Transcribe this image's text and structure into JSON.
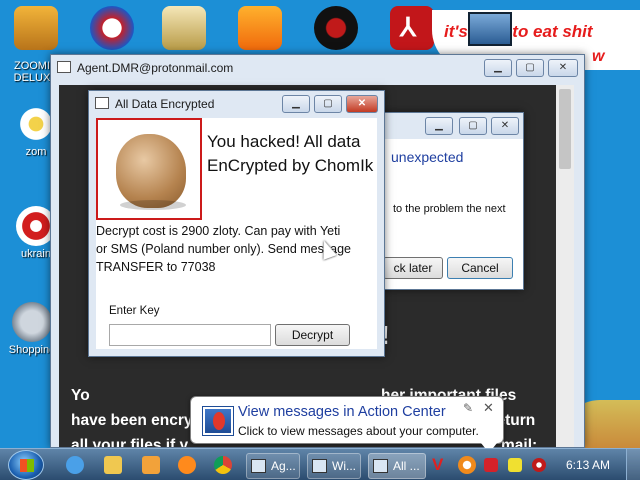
{
  "desktop": {
    "icons": [
      {
        "label_line1": "ZOOMI",
        "label_line2": "DELUX"
      },
      {
        "label_line1": "zom",
        "label_line2": ""
      },
      {
        "label_line1": "ukrain",
        "label_line2": ""
      },
      {
        "label_line1": "Shopping",
        "label_line2": ""
      }
    ],
    "banner_text": "it's time to eat shit",
    "banner_text_tail": "w"
  },
  "main_window": {
    "title": "Agent.DMR@protonmail.com",
    "body_lines": [
      "Yo",
      "have been encrypted with strongest encryption, you can return",
      "all your files if y"
    ],
    "right_fragment": "her important files",
    "right_fragment2": "mail:",
    "exclaim": "!"
  },
  "back_dialog": {
    "heading": "unexpected",
    "text": "to the problem the next",
    "later_label": "ck later",
    "cancel_label": "Cancel"
  },
  "ransom_dialog": {
    "title": "All Data Encrypted",
    "headline_line1": "You hacked! All data",
    "headline_line2": "EnCrypted by ChomIk",
    "message_line1": "Decrypt cost is 2900 zloty. Can pay with Yeti",
    "message_line2": "or SMS (Poland number only). Send message",
    "message_line3": "TRANSFER to 77038",
    "key_label": "Enter Key",
    "key_value": "",
    "decrypt_label": "Decrypt"
  },
  "notification": {
    "title": "View messages in Action Center",
    "subtitle": "Click to view messages about your computer."
  },
  "taskbar": {
    "items": [
      {
        "label": "Ag..."
      },
      {
        "label": "Wi..."
      },
      {
        "label": "All ..."
      }
    ],
    "clock": "6:13 AM"
  },
  "colors": {
    "desktop": "#1c8fd6",
    "main_client": "#2b2b2b",
    "photo_border": "#cc1a1a",
    "link_blue": "#1f3fa0"
  }
}
